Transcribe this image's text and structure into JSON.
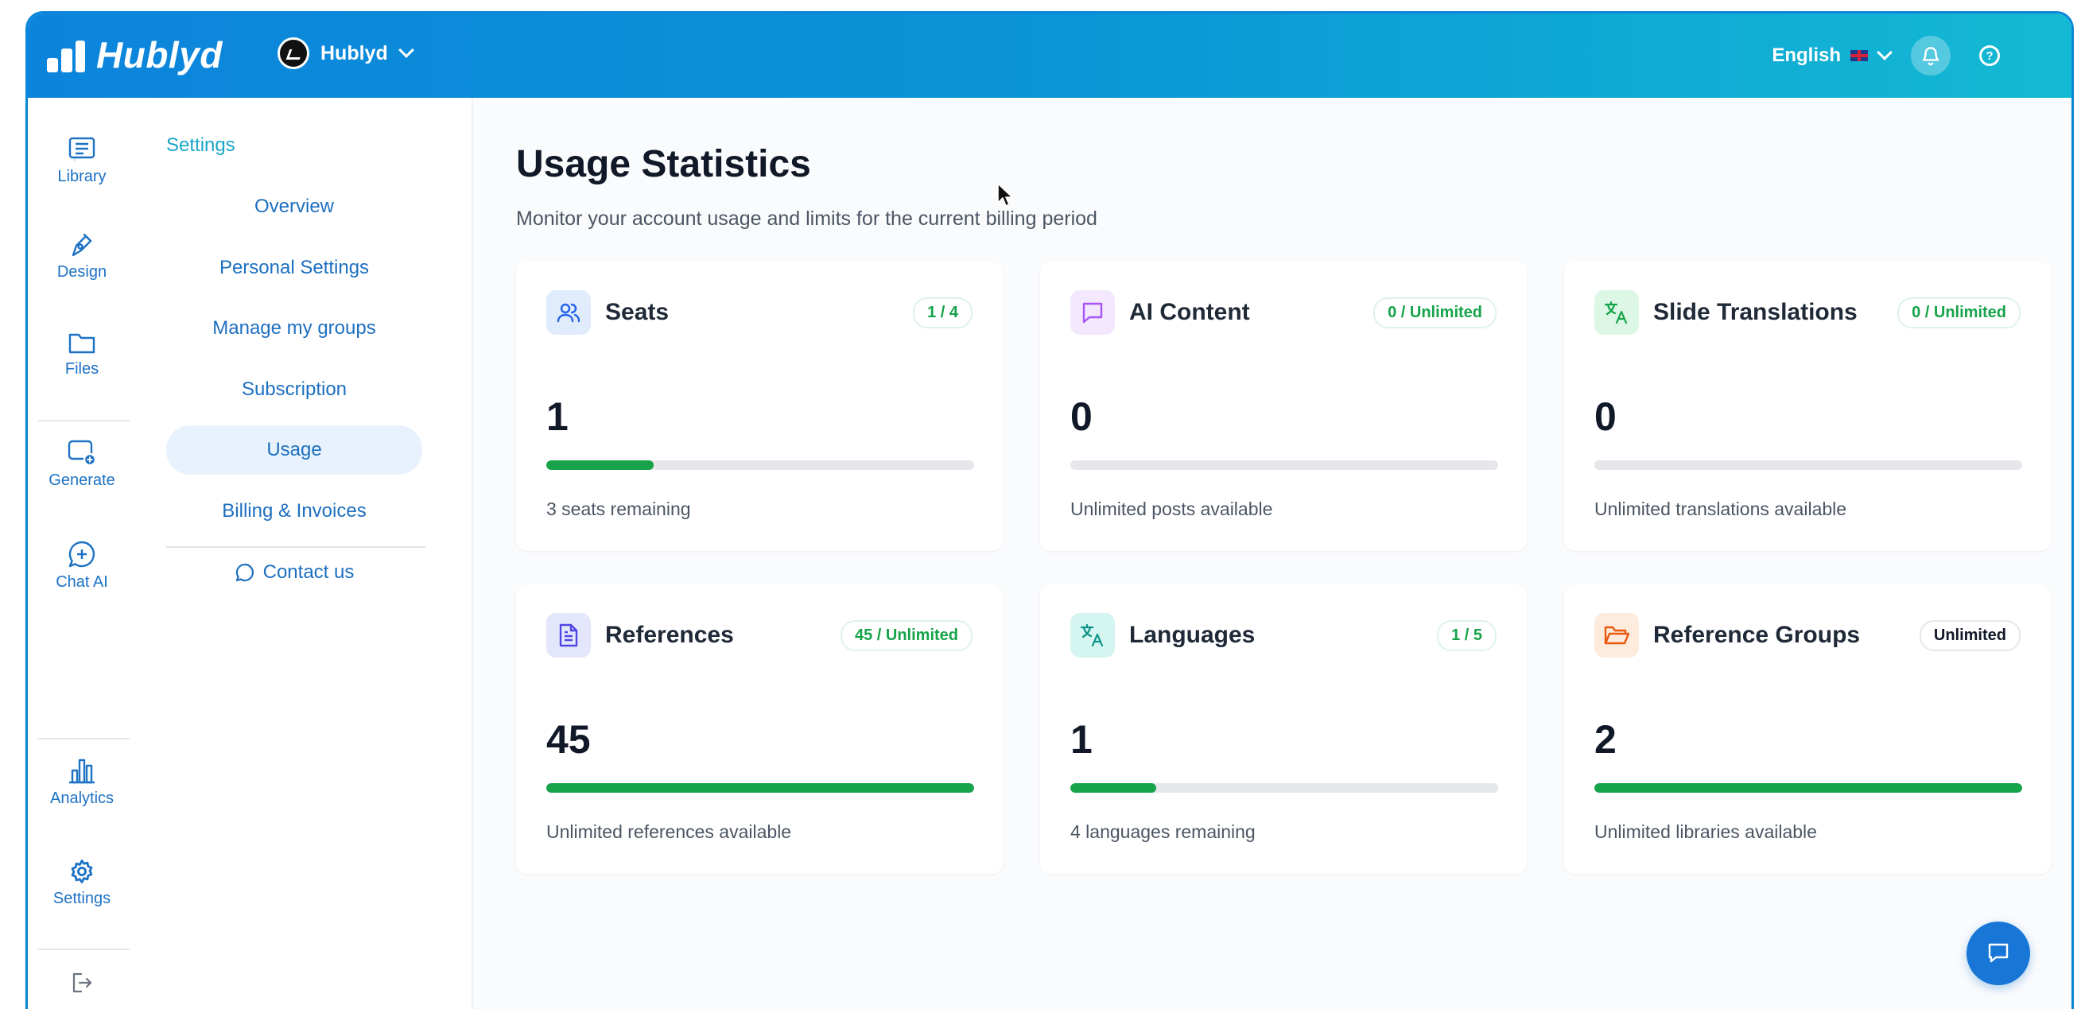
{
  "header": {
    "logo_text": "Hublyd",
    "workspace_name": "Hublyd",
    "language": "English"
  },
  "rail": {
    "items": [
      {
        "label": "Library",
        "icon": "library-icon"
      },
      {
        "label": "Design",
        "icon": "pen-icon"
      },
      {
        "label": "Files",
        "icon": "folder-icon"
      },
      {
        "label": "Generate",
        "icon": "generate-icon"
      },
      {
        "label": "Chat AI",
        "icon": "chat-ai-icon"
      },
      {
        "label": "Analytics",
        "icon": "analytics-icon"
      },
      {
        "label": "Settings",
        "icon": "gear-icon"
      }
    ]
  },
  "subnav": {
    "title": "Settings",
    "items": [
      {
        "label": "Overview"
      },
      {
        "label": "Personal Settings"
      },
      {
        "label": "Manage my groups"
      },
      {
        "label": "Subscription"
      },
      {
        "label": "Usage",
        "active": true
      },
      {
        "label": "Billing & Invoices"
      }
    ],
    "contact_label": "Contact us"
  },
  "page": {
    "title": "Usage Statistics",
    "subtitle": "Monitor your account usage and limits for the current billing period"
  },
  "cards": [
    {
      "title": "Seats",
      "badge": "1 / 4",
      "value": "1",
      "fill": 0.25,
      "note": "3 seats remaining",
      "icon": "users-icon",
      "icon_bg": "#e0ecfb",
      "icon_color": "#2563eb"
    },
    {
      "title": "AI Content",
      "badge": "0 / Unlimited",
      "value": "0",
      "fill": 0,
      "note": "Unlimited posts available",
      "icon": "message-icon",
      "icon_bg": "#f3e8fd",
      "icon_color": "#a855f7"
    },
    {
      "title": "Slide Translations",
      "badge": "0 / Unlimited",
      "value": "0",
      "fill": 0,
      "note": "Unlimited translations available",
      "icon": "translate-icon",
      "icon_bg": "#dcf7e6",
      "icon_color": "#16a34a"
    },
    {
      "title": "References",
      "badge": "45 / Unlimited",
      "value": "45",
      "fill": 1,
      "note": "Unlimited references available",
      "icon": "document-icon",
      "icon_bg": "#e4e7fb",
      "icon_color": "#4f46e5"
    },
    {
      "title": "Languages",
      "badge": "1 / 5",
      "value": "1",
      "fill": 0.2,
      "note": "4 languages remaining",
      "icon": "translate-icon",
      "icon_bg": "#d5f5f1",
      "icon_color": "#0d9488"
    },
    {
      "title": "Reference Groups",
      "badge": "Unlimited",
      "value": "2",
      "fill": 1,
      "note": "Unlimited libraries available",
      "icon": "folder-open-icon",
      "icon_bg": "#fdebdd",
      "icon_color": "#ea580c"
    }
  ]
}
